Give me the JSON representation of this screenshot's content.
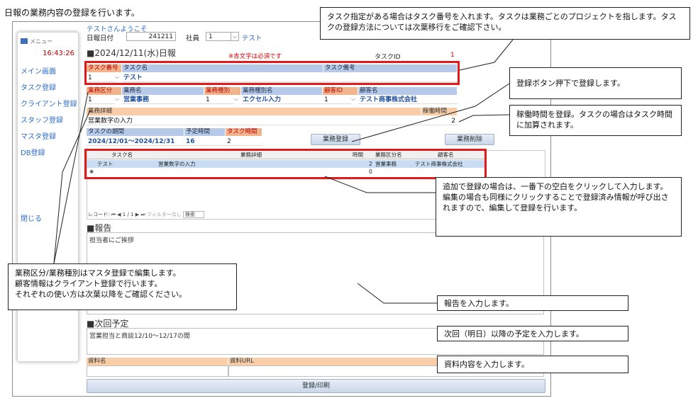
{
  "caption": "日報の業務内容の登録を行います。",
  "sidebar": {
    "title": "メニュー",
    "time": "16:43:26",
    "items": [
      "メイン画面",
      "タスク登録",
      "クライアント登録",
      "スタッフ登録",
      "マスタ登録",
      "DB登録"
    ],
    "close": "閉じる"
  },
  "header": {
    "welcome": "テストさんようこそ",
    "date_label": "日報日付",
    "date_value": "241211",
    "staff_label": "社員",
    "staff_value": "1",
    "staff_name": "テスト",
    "title": "2024/12/11(水)日報",
    "required_note": "※赤文字は必須です",
    "task_id_label": "タスクID",
    "task_id_value": "1"
  },
  "task_row": {
    "headers": [
      "タスク番号",
      "タスク名",
      "タスク備考"
    ],
    "values": [
      "1",
      "テスト",
      ""
    ]
  },
  "work_row": {
    "headers": [
      "業務区分",
      "業務名",
      "業務種別",
      "業務種別名",
      "顧客ID",
      "顧客名"
    ],
    "values": [
      "1",
      "営業事務",
      "1",
      "エクセル入力",
      "1",
      "テスト商事株式会社"
    ]
  },
  "detail": {
    "header": "業務詳細",
    "value": "営業数字の入力",
    "hours_header": "稼働時間",
    "hours_value": "2"
  },
  "period": {
    "headers": [
      "タスクの期間",
      "予定時間",
      "タスク時間"
    ],
    "values": [
      "2024/12/01～2024/12/31",
      "16",
      "2"
    ]
  },
  "buttons": {
    "register": "業務登録",
    "delete": "業務削除",
    "submit": "登録/印刷"
  },
  "datagrid": {
    "headers": [
      "タスク名",
      "業務詳細",
      "時間",
      "業務区分名",
      "顧客名"
    ],
    "rows": [
      [
        "テスト",
        "営業数字の入力",
        "2",
        "営業事務",
        "テスト商事株式会社"
      ]
    ],
    "new_row_marker": "✱",
    "new_row_time": "0",
    "nav": {
      "record_label": "レコード:",
      "position": "1 / 1",
      "filter": "フィルターなし",
      "search": "検索"
    }
  },
  "report": {
    "title": "報告",
    "value": "担当者にご挨拶"
  },
  "next": {
    "title": "次回予定",
    "value": "営業担当と商談12/10～12/17の間"
  },
  "material": {
    "name_header": "資料名",
    "url_header": "資料URL"
  },
  "callouts": {
    "task": "タスク指定がある場合はタスク番号を入れます。タスクは業務ごとのプロジェクトを指します。タスクの登録方法については次葉移行をご確認下さい。",
    "register": "登録ボタン押下で登録します。",
    "hours": "稼働時間を登録。タスクの場合はタスク時間に加算されます。",
    "add": "追加で登録の場合は、一番下の空白をクリックして入力します。編集の場合も同様にクリックすることで登録済み情報が呼び出されますので、編集して登録を行います。",
    "master": "業務区分/業務種別はマスタ登録で編集します。\n顧客情報はクライアント登録で行います。\nそれぞれの使い方は次葉以降をご確認ください。",
    "report": "報告を入力します。",
    "next": "次回（明日）以降の予定を入力します。",
    "material": "資料内容を入力します。"
  }
}
